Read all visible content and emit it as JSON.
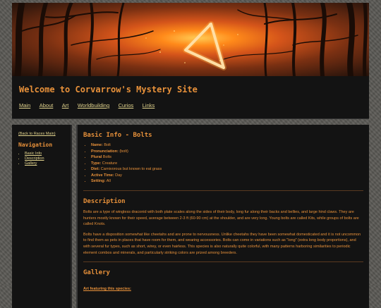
{
  "header": {
    "title": "Welcome to Corvarrow's Mystery Site",
    "nav": [
      "Main",
      "About",
      "Art",
      "Worldbuilding",
      "Curios",
      "Links"
    ]
  },
  "sidebar": {
    "back_link": "(Back to Races Main)",
    "heading": "Navigation",
    "items": [
      "Basic Info",
      "Description",
      "Gallery"
    ]
  },
  "main": {
    "basic_info": {
      "heading": "Basic Info - Bolts",
      "fields": [
        {
          "label": "Name:",
          "value": "Bolt"
        },
        {
          "label": "Pronunciation:",
          "value": "(bolt)"
        },
        {
          "label": "Plural",
          "value": "Bolts"
        },
        {
          "label": "Type:",
          "value": "Creature"
        },
        {
          "label": "Diet:",
          "value": "Carnivorous but known to eat grass"
        },
        {
          "label": "Active Time:",
          "value": "Day"
        },
        {
          "label": "Setting:",
          "value": "All"
        }
      ]
    },
    "description": {
      "heading": "Description",
      "p1": "Bolts are a type of wingless draconid with both plate scales along the sides of their body, long fur along their backs and bellies, and large hind claws. They are hunters mostly known for their speed, average between 2-3 ft (60-90 cm) at the shoulder, and are very long. Young bolts are called Kits, while groups of bolts are called Knots.",
      "p2": "Bolts have a disposition somewhat like cheetahs and are prone to nervousness. Unlike cheetahs they have been somewhat domesticated and it is not uncommon to find them as pets in places that have room for them, and wearing accessories. Bolts can come in variations such as \"long\" (extra long body proportions), and with several fur types, such as short, wirey, or even hairless. This species is also naturally quite colorful, with many patterns harboring similarities to periodic element combos and minerals, and particularly striking colors are prized among breeders."
    },
    "gallery": {
      "heading": "Gallery",
      "link": "Art featuring this species:"
    }
  }
}
